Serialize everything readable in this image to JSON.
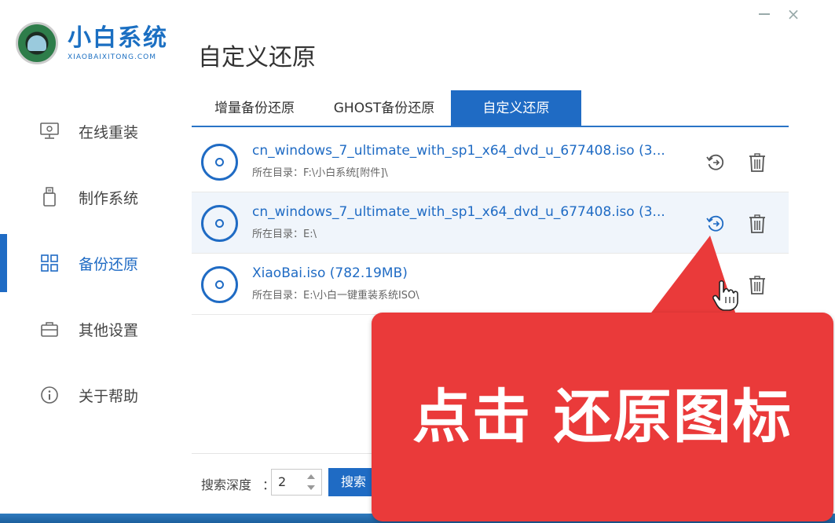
{
  "window": {
    "close_symbol": "×"
  },
  "brand": {
    "name": "小白系统",
    "domain": "XIAOBAIXITONG.COM"
  },
  "sidebar": {
    "items": [
      {
        "label": "在线重装",
        "icon": "monitor-icon"
      },
      {
        "label": "制作系统",
        "icon": "usb-drive-icon"
      },
      {
        "label": "备份还原",
        "icon": "grid-blocks-icon",
        "active": true
      },
      {
        "label": "其他设置",
        "icon": "toolbox-icon"
      },
      {
        "label": "关于帮助",
        "icon": "info-icon"
      }
    ]
  },
  "main": {
    "title": "自定义还原",
    "tabs": [
      {
        "label": "增量备份还原"
      },
      {
        "label": "GHOST备份还原"
      },
      {
        "label": "自定义还原",
        "active": true
      }
    ],
    "iso_files": [
      {
        "name": "cn_windows_7_ultimate_with_sp1_x64_dvd_u_677408.iso (3...",
        "path": "所在目录：F:\\小白系统[附件]\\"
      },
      {
        "name": "cn_windows_7_ultimate_with_sp1_x64_dvd_u_677408.iso (3...",
        "path": "所在目录：E:\\"
      },
      {
        "name": "XiaoBai.iso (782.19MB)",
        "path": "所在目录：E:\\小白一键重装系统ISO\\"
      }
    ],
    "search_depth_label": "搜索深度",
    "search_depth_colon": "：",
    "search_depth_value": "2",
    "search_button": "搜索"
  },
  "callout": {
    "text": "点击 还原图标"
  },
  "colors": {
    "accent": "#1f6bc4",
    "callout": "#ea3a3a"
  }
}
